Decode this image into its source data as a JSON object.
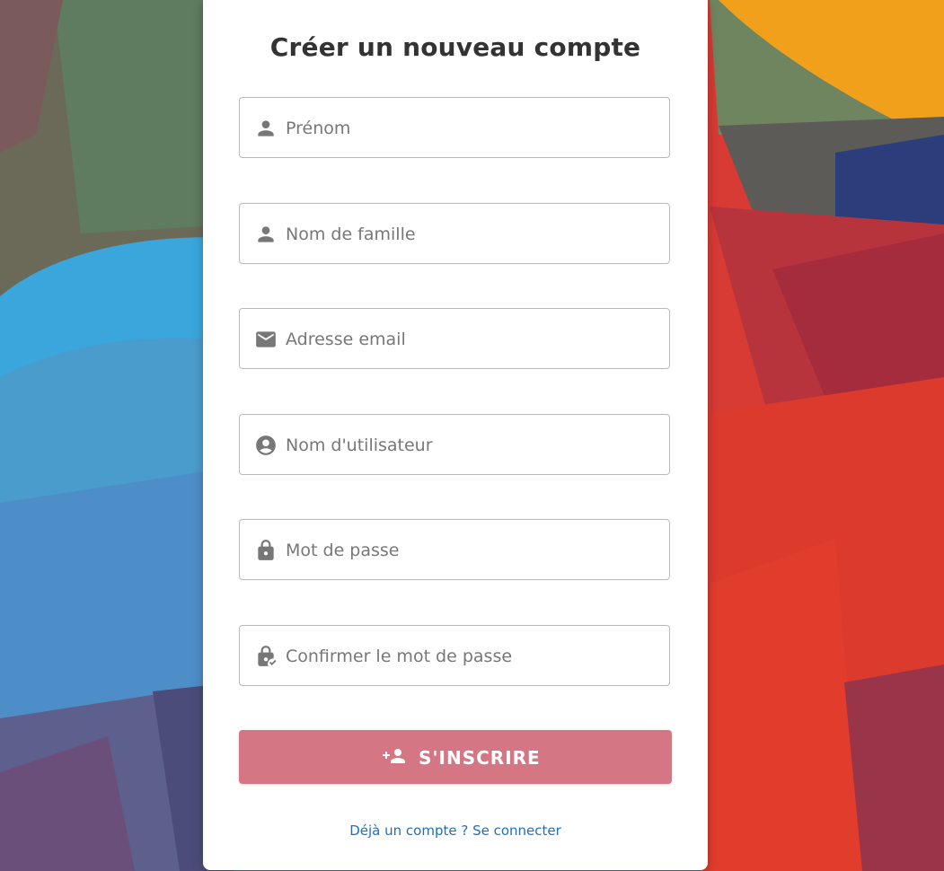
{
  "colors": {
    "accent_button": "#d57685",
    "link": "#1e6fc0",
    "icon": "#777777",
    "title": "#333333"
  },
  "form": {
    "title": "Créer un nouveau compte",
    "fields": [
      {
        "icon": "person-icon",
        "placeholder": "Prénom",
        "value": ""
      },
      {
        "icon": "person-icon",
        "placeholder": "Nom de famille",
        "value": ""
      },
      {
        "icon": "email-icon",
        "placeholder": "Adresse email",
        "value": ""
      },
      {
        "icon": "account-circle-icon",
        "placeholder": "Nom d'utilisateur",
        "value": ""
      },
      {
        "icon": "lock-icon",
        "placeholder": "Mot de passe",
        "value": ""
      },
      {
        "icon": "lock-check-icon",
        "placeholder": "Confirmer le mot de passe",
        "value": ""
      }
    ],
    "submit": {
      "icon": "person-add-icon",
      "label": "S'INSCRIRE"
    },
    "login_link": "Déjà un compte ? Se connecter"
  }
}
